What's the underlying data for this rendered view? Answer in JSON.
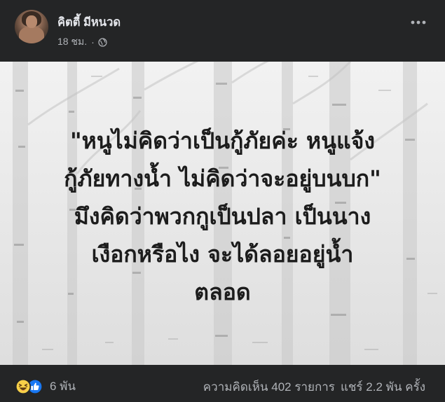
{
  "post": {
    "author": "คิตตี้ มีหนวด",
    "timestamp": "18 ชม.",
    "separator": "·",
    "privacy_icon": "globe-icon",
    "more_icon": "more-horizontal-icon"
  },
  "image": {
    "lines": [
      "\"หนูไม่คิดว่าเป็นกู้ภัยค่ะ หนูแจ้ง",
      "กู้ภัยทางน้ำ ไม่คิดว่าจะอยู่บนบก\"",
      "มึงคิดว่าพวกกูเป็นปลา เป็นนาง",
      "เงือกหรือไง จะได้ลอยอยู่น้ำ",
      "ตลอด"
    ]
  },
  "footer": {
    "reaction_icons": [
      "haha-icon",
      "like-icon"
    ],
    "reaction_count": "6 พัน",
    "comments": "ความคิดเห็น 402 รายการ",
    "shares": "แชร์ 2.2 พัน ครั้ง"
  },
  "colors": {
    "background": "#242526",
    "text_primary": "#e4e6eb",
    "text_secondary": "#b0b3b8",
    "like_blue": "#1877f2",
    "haha_yellow": "#f7d048"
  }
}
